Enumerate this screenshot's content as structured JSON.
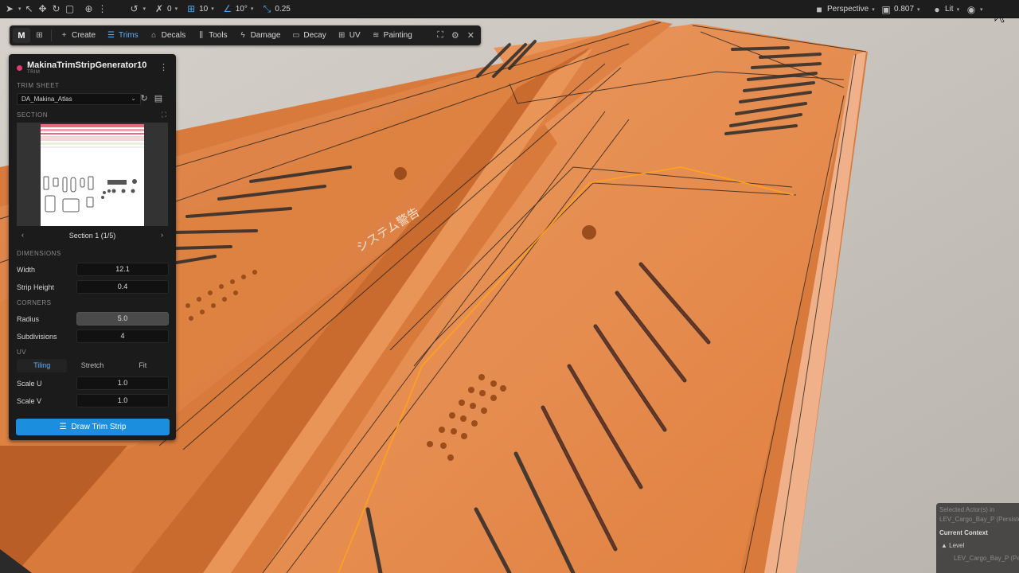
{
  "toolbar": {
    "snap_angle_value": "0",
    "grid_value": "10",
    "rotate_value": "10°",
    "scale_value": "0.25",
    "view_mode": "Perspective",
    "camera_speed": "0.807",
    "lighting_mode": "Lit"
  },
  "mode_toolbar": {
    "logo": "M",
    "items": [
      {
        "label": "Create",
        "icon": "plus-icon"
      },
      {
        "label": "Trims",
        "icon": "list-icon",
        "active": true
      },
      {
        "label": "Decals",
        "icon": "tag-icon"
      },
      {
        "label": "Tools",
        "icon": "sliders-icon"
      },
      {
        "label": "Damage",
        "icon": "bolt-icon"
      },
      {
        "label": "Decay",
        "icon": "frame-icon"
      },
      {
        "label": "UV",
        "icon": "grid-icon"
      },
      {
        "label": "Painting",
        "icon": "layers-icon"
      }
    ]
  },
  "panel": {
    "title": "MakinaTrimStripGenerator10",
    "subtitle": "TRIM",
    "trim_sheet_label": "TRIM SHEET",
    "trim_sheet_value": "DA_Makina_Atlas",
    "section_label": "SECTION",
    "section_nav": "Section 1 (1/5)",
    "dimensions_label": "DIMENSIONS",
    "width_label": "Width",
    "width_value": "12.1",
    "strip_height_label": "Strip Height",
    "strip_height_value": "0.4",
    "corners_label": "CORNERS",
    "radius_label": "Radius",
    "radius_value": "5.0",
    "subdivisions_label": "Subdivisions",
    "subdivisions_value": "4",
    "uv_label": "UV",
    "uv_modes": [
      "Tiling",
      "Stretch",
      "Fit"
    ],
    "scale_u_label": "Scale U",
    "scale_u_value": "1.0",
    "scale_v_label": "Scale V",
    "scale_v_value": "1.0",
    "draw_button": "Draw Trim Strip"
  },
  "outliner": {
    "selected_line1": "Selected Actor(s) in",
    "selected_line2": "LEV_Cargo_Bay_P (Persistent)",
    "context_label": "Current Context",
    "level_label": "Level",
    "level_value": "LEV_Cargo_Bay_P (Persistent)"
  },
  "viewport": {
    "decal_text_jp": "システム警告"
  },
  "colors": {
    "accent_blue": "#1b8fde",
    "hull_orange": "#e5813f",
    "selection_orange": "#ffa21a",
    "dot_pink": "#e03c73"
  }
}
